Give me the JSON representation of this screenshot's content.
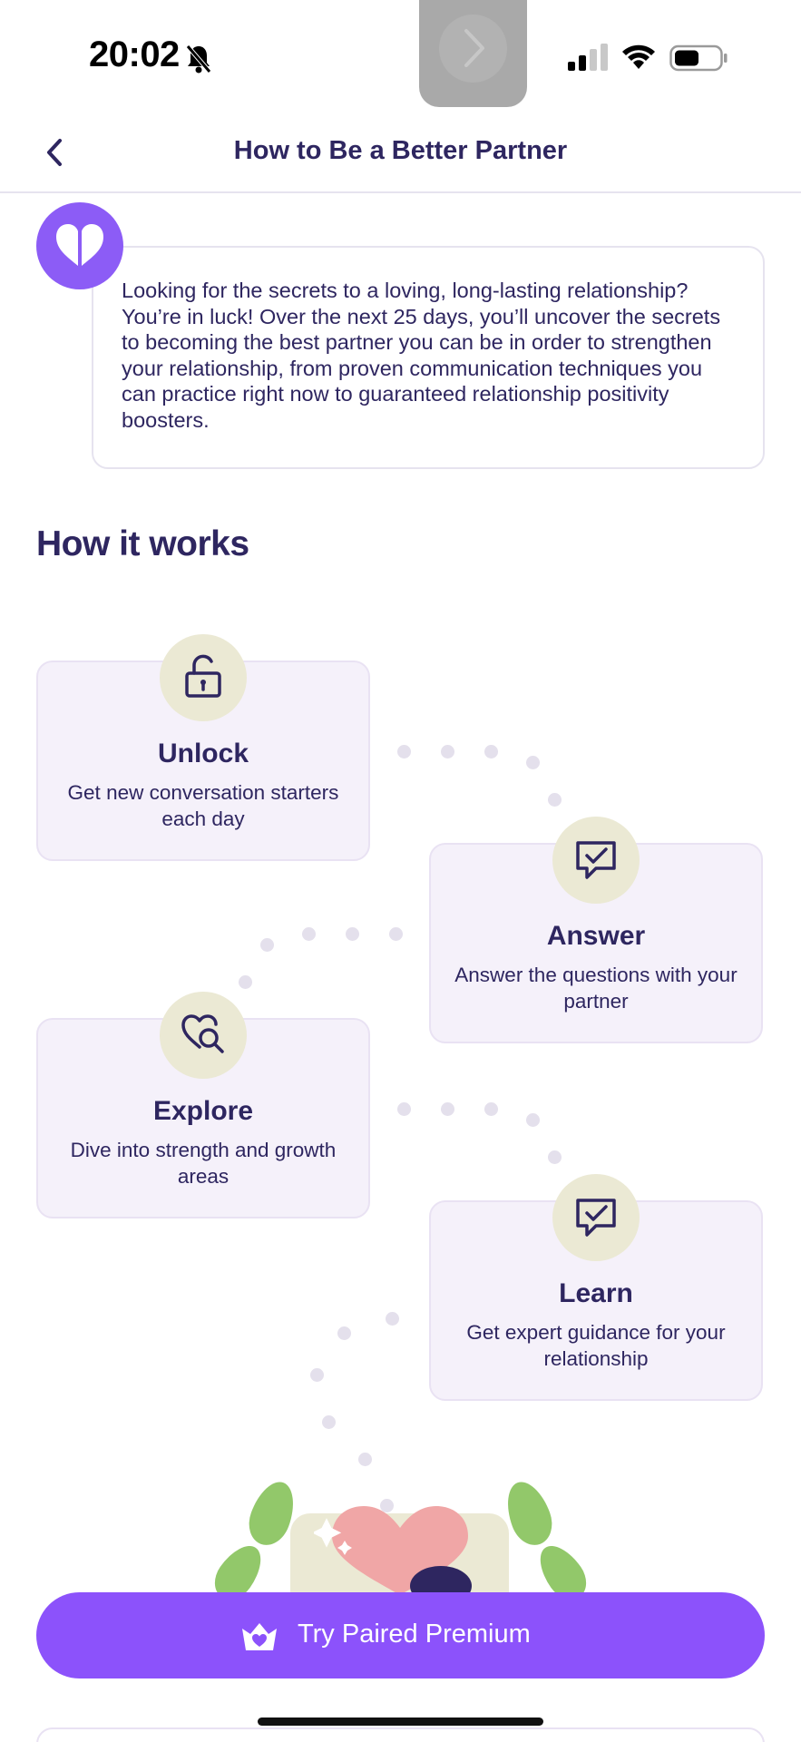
{
  "status_bar": {
    "time": "20:02"
  },
  "nav": {
    "title": "How to Be a Better Partner"
  },
  "intro": {
    "text": "Looking for the secrets to a loving, long-lasting relationship? You’re in luck! Over the next 25 days, you’ll uncover the secrets to becoming the best partner you can be in order to strengthen your relationship, from proven communication techniques you can practice right now to guaranteed relationship positivity boosters."
  },
  "section": {
    "title": "How it works"
  },
  "steps": [
    {
      "title": "Unlock",
      "description": "Get new conversation starters each day",
      "icon": "unlock-icon"
    },
    {
      "title": "Answer",
      "description": "Answer the questions with your partner",
      "icon": "chat-check-icon"
    },
    {
      "title": "Explore",
      "description": "Dive into strength and growth areas",
      "icon": "heart-search-icon"
    },
    {
      "title": "Learn",
      "description": "Get expert guidance for your relationship",
      "icon": "chat-check-icon"
    }
  ],
  "cta": {
    "label": "Try Paired Premium",
    "icon": "crown-heart-icon"
  },
  "colors": {
    "brand_purple": "#8c52fb",
    "text_dark": "#2e2660",
    "card_bg": "#f5f1fa",
    "icon_bg": "#ebe9d4",
    "leaf_green": "#92c86a"
  }
}
